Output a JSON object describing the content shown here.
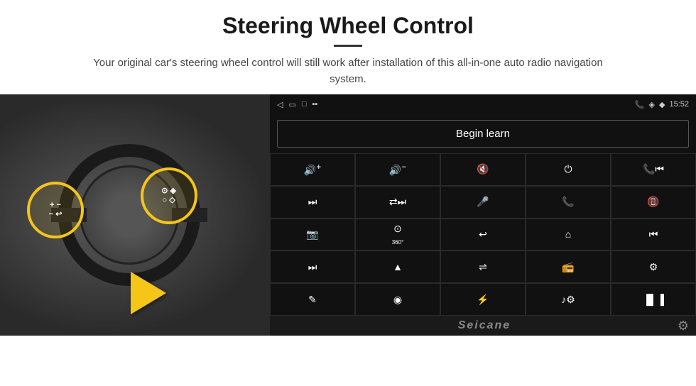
{
  "header": {
    "title": "Steering Wheel Control",
    "subtitle": "Your original car's steering wheel control will still work after installation of this all-in-one auto radio navigation system."
  },
  "status_bar": {
    "time": "15:52",
    "back_icon": "◁",
    "home_icon": "▭",
    "recent_icon": "□",
    "signal_icon": "▪▪",
    "phone_icon": "📞",
    "location_icon": "◈",
    "wifi_icon": "◆"
  },
  "begin_learn": {
    "label": "Begin learn"
  },
  "seicane": {
    "brand": "Seicane"
  },
  "controls": [
    {
      "id": "vol-up",
      "icon": "🔊+"
    },
    {
      "id": "vol-down",
      "icon": "🔊−"
    },
    {
      "id": "mute",
      "icon": "🔇"
    },
    {
      "id": "power",
      "icon": "⏻"
    },
    {
      "id": "phone-prev",
      "icon": "📞⏮"
    },
    {
      "id": "next-track",
      "icon": "⏭"
    },
    {
      "id": "shuffle",
      "icon": "⇄⏭"
    },
    {
      "id": "mic",
      "icon": "🎤"
    },
    {
      "id": "phone",
      "icon": "📞"
    },
    {
      "id": "hang-up",
      "icon": "📵"
    },
    {
      "id": "car-cam",
      "icon": "🚗"
    },
    {
      "id": "360-view",
      "icon": "⊙"
    },
    {
      "id": "back",
      "icon": "↩"
    },
    {
      "id": "home",
      "icon": "⌂"
    },
    {
      "id": "skip-back",
      "icon": "⏮"
    },
    {
      "id": "skip-fwd",
      "icon": "⏭"
    },
    {
      "id": "nav",
      "icon": "▲"
    },
    {
      "id": "eq",
      "icon": "⇌"
    },
    {
      "id": "radio",
      "icon": "📻"
    },
    {
      "id": "settings",
      "icon": "⚙"
    },
    {
      "id": "pen",
      "icon": "✎"
    },
    {
      "id": "circle-dot",
      "icon": "⊙"
    },
    {
      "id": "bluetooth",
      "icon": "⚡"
    },
    {
      "id": "music",
      "icon": "♪"
    },
    {
      "id": "equalizer",
      "icon": "|||"
    }
  ]
}
